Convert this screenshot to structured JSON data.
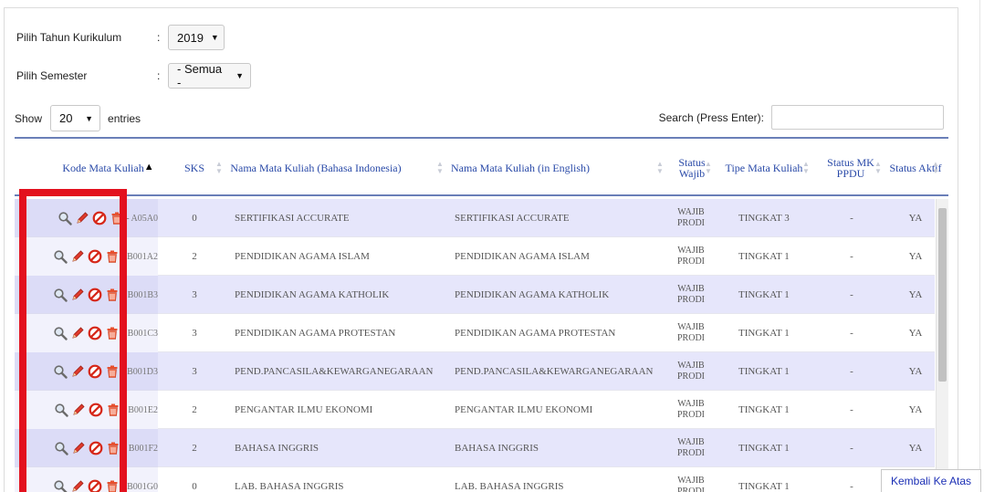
{
  "filters": {
    "tahun_label": "Pilih Tahun Kurikulum",
    "tahun_value": "2019",
    "semester_label": "Pilih Semester",
    "semester_value": "- Semua -",
    "colon": ":"
  },
  "table_controls": {
    "show_label": "Show",
    "entries_value": "20",
    "entries_label": "entries",
    "search_label": "Search (Press Enter):",
    "search_value": ""
  },
  "columns": [
    {
      "key": "kode",
      "label": "Kode Mata Kuliah",
      "sorted": "asc"
    },
    {
      "key": "sks",
      "label": "SKS"
    },
    {
      "key": "nama_id",
      "label": "Nama Mata Kuliah (Bahasa Indonesia)"
    },
    {
      "key": "nama_en",
      "label": "Nama Mata Kuliah (in English)"
    },
    {
      "key": "status_wajib",
      "label": "Status Wajib"
    },
    {
      "key": "tipe",
      "label": "Tipe Mata Kuliah"
    },
    {
      "key": "status_ppdu",
      "label": "Status MK PPDU"
    },
    {
      "key": "status_aktif",
      "label": "Status Aktif"
    }
  ],
  "rows": [
    {
      "kode": "- A05A0",
      "kode_visible": "- A",
      "kode_tail": "T05A0",
      "sks": "0",
      "nama_id": "SERTIFIKASI ACCURATE",
      "nama_en": "SERTIFIKASI ACCURATE",
      "wajib_1": "WAJIB",
      "wajib_2": "PRODI",
      "tipe": "TINGKAT 3",
      "ppdu": "-",
      "aktif": "YA"
    },
    {
      "kode": "- B001A2",
      "kode_visible": "- ",
      "kode_tail": "B001A2",
      "sks": "2",
      "nama_id": "PENDIDIKAN AGAMA ISLAM",
      "nama_en": "PENDIDIKAN AGAMA ISLAM",
      "wajib_1": "WAJIB",
      "wajib_2": "PRODI",
      "tipe": "TINGKAT 1",
      "ppdu": "-",
      "aktif": "YA"
    },
    {
      "kode": "- B001B3",
      "kode_visible": "- ",
      "kode_tail": "B001B3",
      "sks": "3",
      "nama_id": "PENDIDIKAN AGAMA KATHOLIK",
      "nama_en": "PENDIDIKAN AGAMA KATHOLIK",
      "wajib_1": "WAJIB",
      "wajib_2": "PRODI",
      "tipe": "TINGKAT 1",
      "ppdu": "-",
      "aktif": "YA"
    },
    {
      "kode": "- B001C3",
      "kode_visible": "- ",
      "kode_tail": "B001C3",
      "sks": "3",
      "nama_id": "PENDIDIKAN AGAMA PROTESTAN",
      "nama_en": "PENDIDIKAN AGAMA PROTESTAN",
      "wajib_1": "WAJIB",
      "wajib_2": "PRODI",
      "tipe": "TINGKAT 1",
      "ppdu": "-",
      "aktif": "YA"
    },
    {
      "kode": "- B001D3",
      "kode_visible": "- ",
      "kode_tail": "B001D3",
      "sks": "3",
      "nama_id": "PEND.PANCASILA&KEWARGANEGARAAN",
      "nama_en": "PEND.PANCASILA&KEWARGANEGARAAN",
      "wajib_1": "WAJIB",
      "wajib_2": "PRODI",
      "tipe": "TINGKAT 1",
      "ppdu": "-",
      "aktif": "YA"
    },
    {
      "kode": "- B001E2",
      "kode_visible": "- ",
      "kode_tail": "B001E2",
      "sks": "2",
      "nama_id": "PENGANTAR ILMU EKONOMI",
      "nama_en": "PENGANTAR ILMU EKONOMI",
      "wajib_1": "WAJIB",
      "wajib_2": "PRODI",
      "tipe": "TINGKAT 1",
      "ppdu": "-",
      "aktif": "YA"
    },
    {
      "kode": "- B001F2",
      "kode_visible": "- ",
      "kode_tail": "B001F2",
      "sks": "2",
      "nama_id": "BAHASA INGGRIS",
      "nama_en": "BAHASA INGGRIS",
      "wajib_1": "WAJIB",
      "wajib_2": "PRODI",
      "tipe": "TINGKAT 1",
      "ppdu": "-",
      "aktif": "YA"
    },
    {
      "kode": "- B001G0",
      "kode_visible": "- ",
      "kode_tail": "B001G0",
      "sks": "0",
      "nama_id": "LAB. BAHASA INGGRIS",
      "nama_en": "LAB. BAHASA INGGRIS",
      "wajib_1": "WAJIB",
      "wajib_2": "PRODI",
      "tipe": "TINGKAT 1",
      "ppdu": "-",
      "aktif": "YA"
    }
  ],
  "actions": {
    "view_icon": "magnifier-icon",
    "edit_icon": "pencil-icon",
    "disable_icon": "no-entry-icon",
    "delete_icon": "trash-icon"
  },
  "back_to_top": "Kembali Ke Atas",
  "colors": {
    "header_text": "#2a4aa8",
    "header_rule": "#6a7fb8",
    "row_odd": "#e6e6fb",
    "highlight": "#e3111e",
    "link": "#1b2fb5"
  }
}
